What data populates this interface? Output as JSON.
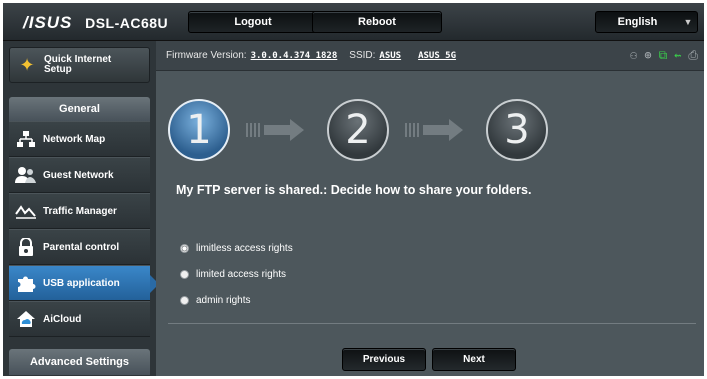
{
  "header": {
    "logo": "/ISUS",
    "model": "DSL-AC68U",
    "logout_label": "Logout",
    "reboot_label": "Reboot",
    "language": "English"
  },
  "info": {
    "firmware_label": "Firmware Version:",
    "firmware_value": "3.0.0.4.374_1828",
    "ssid_label": "SSID:",
    "ssid_1": "ASUS",
    "ssid_2": "ASUS_5G"
  },
  "sidebar": {
    "quick_setup": "Quick Internet Setup",
    "general_header": "General",
    "items": [
      {
        "label": "Network Map",
        "icon": "network-map-icon"
      },
      {
        "label": "Guest Network",
        "icon": "guest-network-icon"
      },
      {
        "label": "Traffic Manager",
        "icon": "traffic-manager-icon"
      },
      {
        "label": "Parental control",
        "icon": "lock-icon"
      },
      {
        "label": "USB application",
        "icon": "puzzle-icon",
        "active": true
      },
      {
        "label": "AiCloud",
        "icon": "cloud-house-icon"
      }
    ],
    "advanced_header": "Advanced Settings"
  },
  "wizard": {
    "steps": [
      "1",
      "2",
      "3"
    ],
    "current_step": 1,
    "heading": "My FTP server is shared.: Decide how to share your folders.",
    "options": [
      {
        "label": "limitless access rights",
        "selected": true
      },
      {
        "label": "limited access rights",
        "selected": false
      },
      {
        "label": "admin rights",
        "selected": false
      }
    ],
    "previous_label": "Previous",
    "next_label": "Next"
  },
  "colors": {
    "active_menu": "#2a6aa5",
    "status_green": "#39d24a"
  }
}
